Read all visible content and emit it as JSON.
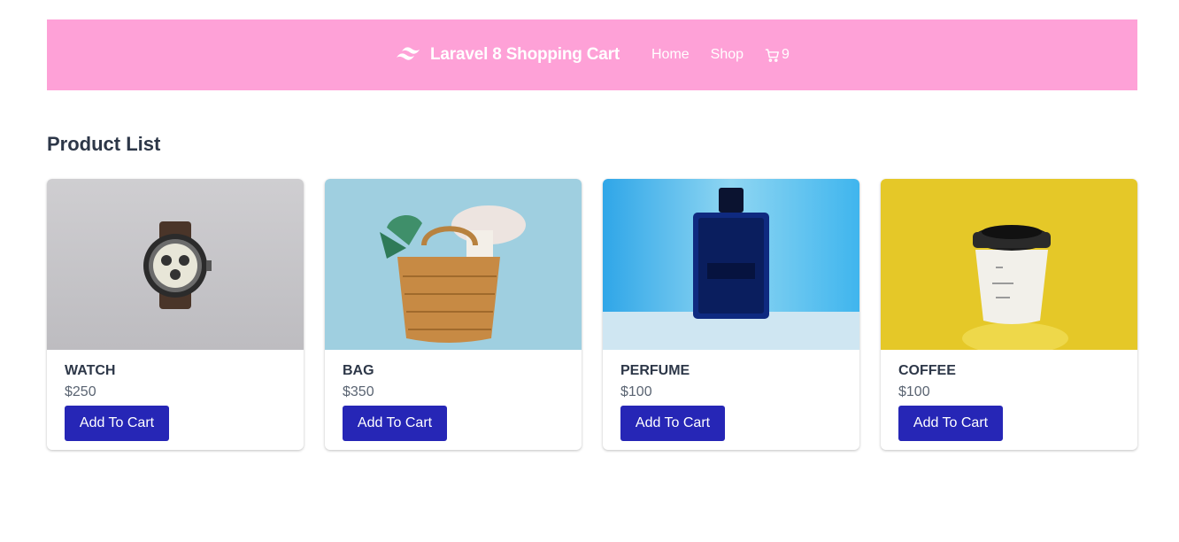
{
  "nav": {
    "brand": "Laravel 8 Shopping Cart",
    "brand_logo_icon": "tailwind-wave-icon",
    "links": [
      {
        "label": "Home"
      },
      {
        "label": "Shop"
      }
    ],
    "cart_icon": "cart-icon",
    "cart_count": "9",
    "background": "#fea1d7"
  },
  "main": {
    "title": "Product List",
    "add_to_cart_label": "Add To Cart",
    "button_color": "#2626b6",
    "products": [
      {
        "name": "WATCH",
        "price": "$250",
        "image": "watch-photo"
      },
      {
        "name": "BAG",
        "price": "$350",
        "image": "bag-photo"
      },
      {
        "name": "PERFUME",
        "price": "$100",
        "image": "perfume-photo"
      },
      {
        "name": "COFFEE",
        "price": "$100",
        "image": "coffee-photo"
      }
    ]
  }
}
